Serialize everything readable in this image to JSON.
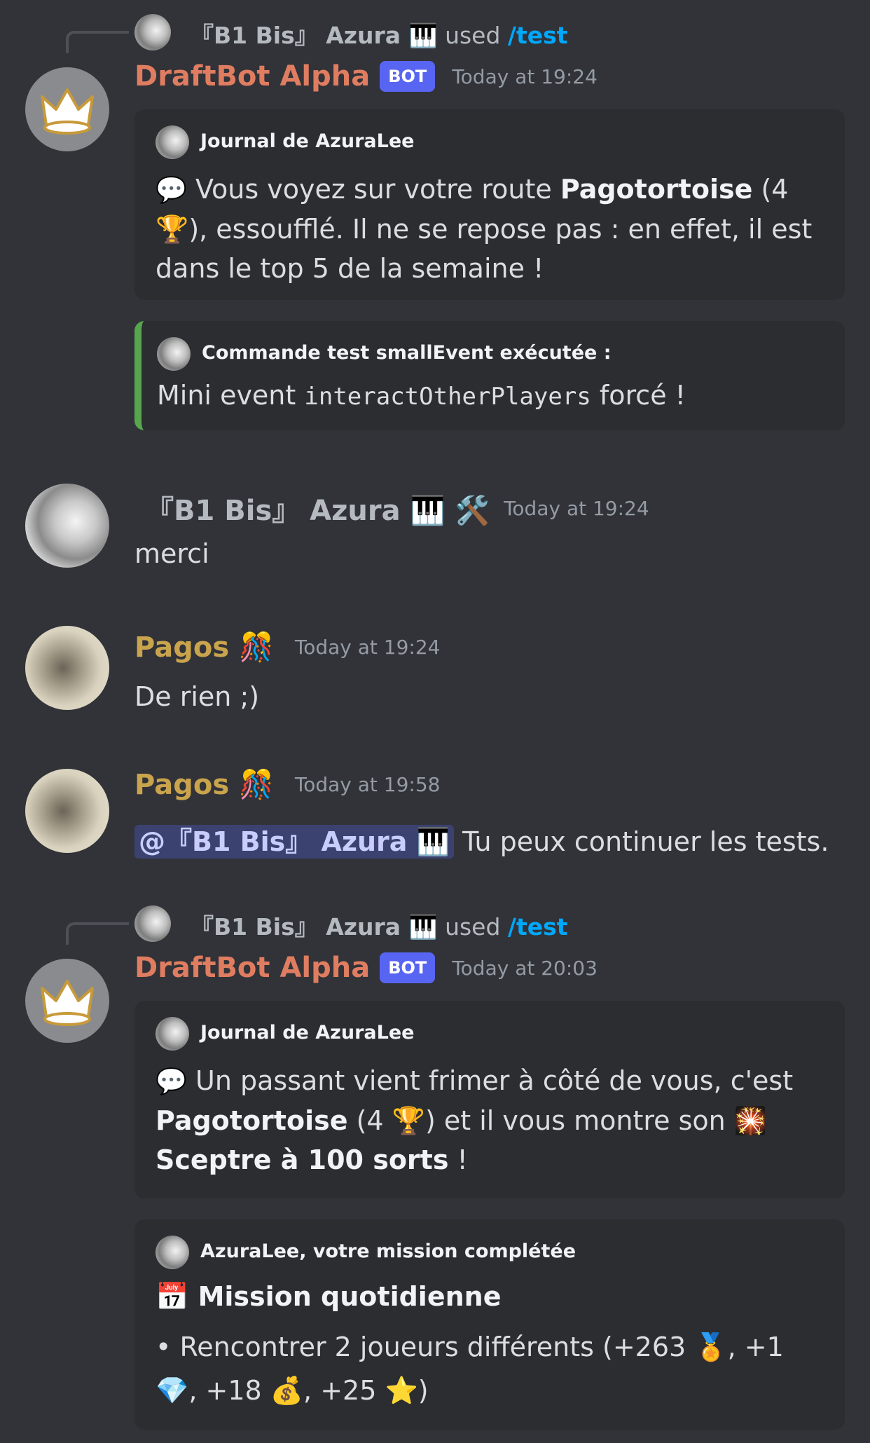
{
  "messages": {
    "m1": {
      "reply": {
        "name": "『B1 Bis』 Azura 🎹",
        "used": "used",
        "command": "/test"
      },
      "author": "DraftBot Alpha",
      "tag": "BOT",
      "time": "Today at 19:24",
      "embed1": {
        "title": "Journal de AzuraLee",
        "emoji": "💬",
        "text1": "Vous voyez sur votre route",
        "bold1": "Pagotortoise",
        "text2": "(4 🏆), essoufflé. Il ne se repose pas : en effet, il est dans le top 5 de la semaine !"
      },
      "embed2": {
        "title": "Commande test smallEvent exécutée :",
        "text1": "Mini event",
        "code": "interactOtherPlayers",
        "text2": "forcé !"
      }
    },
    "m2": {
      "author": "『B1 Bis』 Azura 🎹 🛠️",
      "time": "Today at 19:24",
      "text": "merci"
    },
    "m3": {
      "author": "Pagos 🎊",
      "time": "Today at 19:24",
      "text": "De rien ;)"
    },
    "m4": {
      "author": "Pagos 🎊",
      "time": "Today at 19:58",
      "mention": "@『B1 Bis』 Azura 🎹",
      "text": "Tu peux continuer les tests."
    },
    "m5": {
      "reply": {
        "name": "『B1 Bis』 Azura 🎹",
        "used": "used",
        "command": "/test"
      },
      "author": "DraftBot Alpha",
      "tag": "BOT",
      "time": "Today at 20:03",
      "embed1": {
        "title": "Journal de AzuraLee",
        "emoji": "💬",
        "text1": "Un passant vient frimer à côté de vous, c'est",
        "bold1": "Pagotortoise",
        "text2": "(4 🏆) et il vous montre son 🎇",
        "bold2": "Sceptre à 100 sorts",
        "text3": "!"
      },
      "embed2": {
        "title": "AzuraLee, votre mission complétée",
        "heading_emoji": "📅",
        "heading": "Mission quotidienne",
        "text": "• Rencontrer 2 joueurs différents (+263 🏅, +1 💎, +18 💰, +25 ⭐)"
      }
    }
  },
  "colors": {
    "background": "#313338",
    "bot_name": "#e07d61",
    "pagos_name": "#c9a44c",
    "link": "#00a8fc",
    "bot_tag": "#5865f2",
    "embed_accent": "#57a64e"
  }
}
